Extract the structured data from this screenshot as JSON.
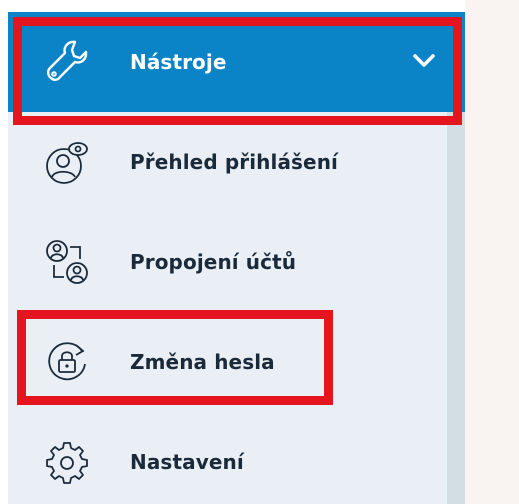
{
  "menu": {
    "items": [
      {
        "label": "Nástroje",
        "icon": "wrench-icon",
        "expanded": true,
        "active": true
      },
      {
        "label": "Přehled přihlášení",
        "icon": "login-overview-icon"
      },
      {
        "label": "Propojení účtů",
        "icon": "linked-accounts-icon"
      },
      {
        "label": "Změna hesla",
        "icon": "lock-refresh-icon"
      },
      {
        "label": "Nastavení",
        "icon": "gear-icon"
      }
    ]
  },
  "colors": {
    "active_bg": "#0a84c6",
    "highlight": "#e4151f",
    "sidebar_bg": "#e9eff4",
    "text": "#1b2a3a"
  }
}
